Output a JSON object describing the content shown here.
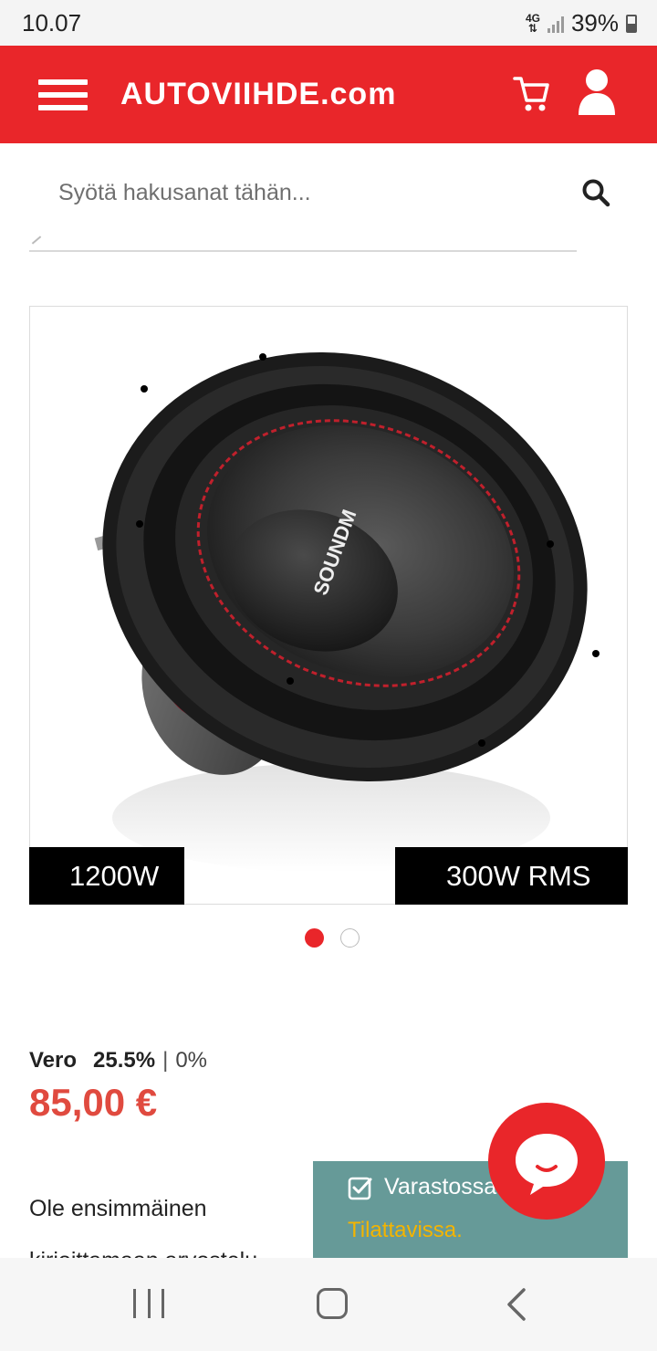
{
  "status_bar": {
    "time": "10.07",
    "network": "4G",
    "battery": "39%"
  },
  "header": {
    "brand": "AUTOVIIHDE.com",
    "icons": [
      "menu-icon",
      "cart-icon",
      "user-icon"
    ],
    "color": "#e9262a"
  },
  "search": {
    "placeholder": "Syötä hakusanat tähän...",
    "value": ""
  },
  "product": {
    "image_badges": {
      "left": "1200W",
      "right": "300W RMS"
    },
    "image_logo_text": "SOUNDM",
    "carousel": {
      "total": 2,
      "active_index": 0
    },
    "tax": {
      "label": "Vero",
      "active": "25.5%",
      "separator": "|",
      "inactive": "0%"
    },
    "price": "85,00 €",
    "review_prompt": "Ole ensimmäinen",
    "review_prompt_cont": "kirjoittamaan arvostelu"
  },
  "stock": {
    "status": "Varastossa",
    "note": "Tilattavissa."
  },
  "colors": {
    "accent": "#e9262a",
    "price": "#e04a3f",
    "stock_bg": "#669a98",
    "stock_note": "#f4b400"
  }
}
